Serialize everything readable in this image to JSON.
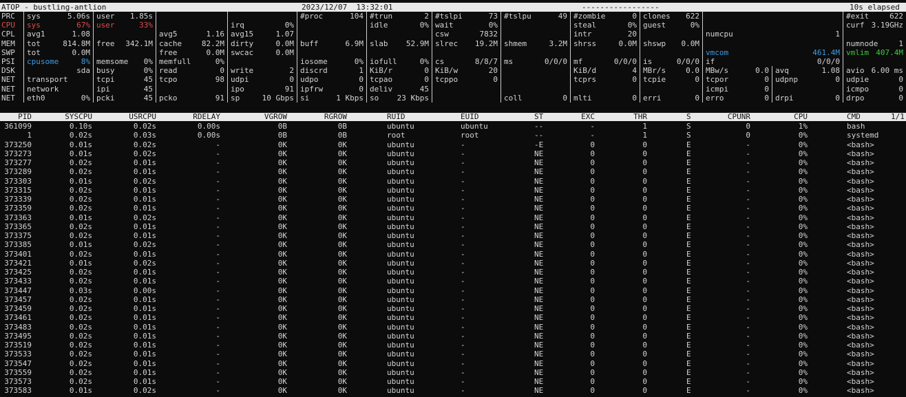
{
  "title": {
    "left": "ATOP - bustling-antlion",
    "datetime": "2023/12/07  13:32:01",
    "dashes": "-----------------",
    "elapsed": "10s elapsed"
  },
  "sysrows": [
    {
      "label": "PRC",
      "cells": [
        [
          "sys",
          "5.06s"
        ],
        [
          "user",
          "1.85s"
        ],
        [
          "",
          ""
        ],
        [
          "",
          ""
        ],
        [
          "#proc",
          "104"
        ],
        [
          "#trun",
          "2"
        ],
        [
          "#tslpi",
          "73"
        ],
        [
          "#tslpu",
          "49"
        ],
        [
          "#zombie",
          "0"
        ],
        [
          "clones",
          "622"
        ],
        [
          "",
          ""
        ],
        [
          "#exit",
          "622"
        ]
      ]
    },
    {
      "label": "CPU",
      "labelColor": "red",
      "cells": [
        [
          "sys",
          "67%",
          "red"
        ],
        [
          "user",
          "33%",
          "red"
        ],
        [
          "",
          ""
        ],
        [
          "irq",
          "0%"
        ],
        [
          "",
          ""
        ],
        [
          "idle",
          "0%"
        ],
        [
          "wait",
          "0%"
        ],
        [
          "",
          ""
        ],
        [
          "steal",
          "0%"
        ],
        [
          "guest",
          "0%"
        ],
        [
          "",
          ""
        ],
        [
          "curf",
          "3.19GHz"
        ]
      ]
    },
    {
      "label": "CPL",
      "cells": [
        [
          "avg1",
          "1.08"
        ],
        [
          "",
          ""
        ],
        [
          "avg5",
          "1.16"
        ],
        [
          "avg15",
          "1.07"
        ],
        [
          "",
          ""
        ],
        [
          "",
          ""
        ],
        [
          "csw",
          "7832"
        ],
        [
          "",
          ""
        ],
        [
          "intr",
          "20"
        ],
        [
          "",
          ""
        ],
        [
          "numcpu",
          "1"
        ],
        [
          "",
          ""
        ]
      ]
    },
    {
      "label": "MEM",
      "cells": [
        [
          "tot",
          "814.8M"
        ],
        [
          "free",
          "342.1M"
        ],
        [
          "cache",
          "82.2M"
        ],
        [
          "dirty",
          "0.0M"
        ],
        [
          "buff",
          "6.9M"
        ],
        [
          "slab",
          "52.9M"
        ],
        [
          "slrec",
          "19.2M"
        ],
        [
          "shmem",
          "3.2M"
        ],
        [
          "shrss",
          "0.0M"
        ],
        [
          "shswp",
          "0.0M"
        ],
        [
          "",
          ""
        ],
        [
          "numnode",
          "1"
        ]
      ]
    },
    {
      "label": "SWP",
      "cells": [
        [
          "tot",
          "0.0M"
        ],
        [
          "",
          ""
        ],
        [
          "free",
          "0.0M"
        ],
        [
          "swcac",
          "0.0M"
        ],
        [
          "",
          ""
        ],
        [
          "",
          ""
        ],
        [
          "",
          ""
        ],
        [
          "",
          ""
        ],
        [
          "",
          ""
        ],
        [
          "",
          ""
        ],
        [
          "vmcom",
          "461.4M",
          "blue"
        ],
        [
          "vmlim",
          "407.4M",
          "green"
        ]
      ]
    },
    {
      "label": "PSI",
      "cells": [
        [
          "cpusome",
          "8%",
          "blue"
        ],
        [
          "memsome",
          "0%"
        ],
        [
          "memfull",
          "0%"
        ],
        [
          "",
          ""
        ],
        [
          "iosome",
          "0%"
        ],
        [
          "iofull",
          "0%"
        ],
        [
          "cs",
          "8/8/7"
        ],
        [
          "ms",
          "0/0/0"
        ],
        [
          "mf",
          "0/0/0"
        ],
        [
          "is",
          "0/0/0"
        ],
        [
          "if",
          "0/0/0"
        ],
        [
          "",
          ""
        ]
      ]
    },
    {
      "label": "DSK",
      "cells": [
        [
          "",
          "sda"
        ],
        [
          "busy",
          "0%"
        ],
        [
          "read",
          "0"
        ],
        [
          "write",
          "2"
        ],
        [
          "discrd",
          "1"
        ],
        [
          "KiB/r",
          "0"
        ],
        [
          "KiB/w",
          "20"
        ],
        [
          "",
          ""
        ],
        [
          "KiB/d",
          "4"
        ],
        [
          "MBr/s",
          "0.0"
        ],
        [
          "MBw/s",
          "0.0"
        ],
        [
          "avq",
          "1.08"
        ],
        [
          "avio",
          "6.00 ms"
        ]
      ]
    },
    {
      "label": "NET",
      "cells": [
        [
          "transport",
          ""
        ],
        [
          "tcpi",
          "45"
        ],
        [
          "tcpo",
          "98"
        ],
        [
          "udpi",
          "0"
        ],
        [
          "udpo",
          "0"
        ],
        [
          "tcpao",
          "0"
        ],
        [
          "tcppo",
          "0"
        ],
        [
          "",
          ""
        ],
        [
          "tcprs",
          "0"
        ],
        [
          "tcpie",
          "0"
        ],
        [
          "tcpor",
          "0"
        ],
        [
          "udpnp",
          "0"
        ],
        [
          "udpie",
          "0"
        ]
      ]
    },
    {
      "label": "NET",
      "cells": [
        [
          "network",
          ""
        ],
        [
          "ipi",
          "45"
        ],
        [
          "",
          ""
        ],
        [
          "ipo",
          "91"
        ],
        [
          "ipfrw",
          "0"
        ],
        [
          "deliv",
          "45"
        ],
        [
          "",
          ""
        ],
        [
          "",
          ""
        ],
        [
          "",
          ""
        ],
        [
          "",
          ""
        ],
        [
          "icmpi",
          "0"
        ],
        [
          "",
          ""
        ],
        [
          "icmpo",
          "0"
        ]
      ]
    },
    {
      "label": "NET",
      "cells": [
        [
          "eth0",
          "0%"
        ],
        [
          "pcki",
          "45"
        ],
        [
          "pcko",
          "91"
        ],
        [
          "sp",
          "10 Gbps"
        ],
        [
          "si",
          "1 Kbps"
        ],
        [
          "so",
          "23 Kbps"
        ],
        [
          "",
          ""
        ],
        [
          "coll",
          "0"
        ],
        [
          "mlti",
          "0"
        ],
        [
          "erri",
          "0"
        ],
        [
          "erro",
          "0"
        ],
        [
          "drpi",
          "0"
        ],
        [
          "drpo",
          "0"
        ]
      ]
    }
  ],
  "columns": [
    "PID",
    "SYSCPU",
    "USRCPU",
    "RDELAY",
    "VGROW",
    "RGROW",
    "RUID",
    "EUID",
    "ST",
    "EXC",
    "THR",
    "S",
    "CPUNR",
    "CPU",
    "CMD",
    "1/1"
  ],
  "processes": [
    [
      "361099",
      "0.10s",
      "0.02s",
      "0.00s",
      "0B",
      "0B",
      "ubuntu",
      "ubuntu",
      "--",
      "-",
      "1",
      "S",
      "0",
      "1%",
      "bash"
    ],
    [
      "1",
      "0.02s",
      "0.03s",
      "0.00s",
      "0B",
      "0B",
      "root",
      "root",
      "--",
      "-",
      "1",
      "S",
      "0",
      "0%",
      "systemd"
    ],
    [
      "373250",
      "0.01s",
      "0.02s",
      "-",
      "0K",
      "0K",
      "ubuntu",
      "-",
      "-E",
      "0",
      "0",
      "E",
      "-",
      "0%",
      "<bash>"
    ],
    [
      "373273",
      "0.01s",
      "0.02s",
      "-",
      "0K",
      "0K",
      "ubuntu",
      "-",
      "NE",
      "0",
      "0",
      "E",
      "-",
      "0%",
      "<bash>"
    ],
    [
      "373277",
      "0.02s",
      "0.01s",
      "-",
      "0K",
      "0K",
      "ubuntu",
      "-",
      "NE",
      "0",
      "0",
      "E",
      "-",
      "0%",
      "<bash>"
    ],
    [
      "373289",
      "0.02s",
      "0.01s",
      "-",
      "0K",
      "0K",
      "ubuntu",
      "-",
      "NE",
      "0",
      "0",
      "E",
      "-",
      "0%",
      "<bash>"
    ],
    [
      "373303",
      "0.01s",
      "0.02s",
      "-",
      "0K",
      "0K",
      "ubuntu",
      "-",
      "NE",
      "0",
      "0",
      "E",
      "-",
      "0%",
      "<bash>"
    ],
    [
      "373315",
      "0.02s",
      "0.01s",
      "-",
      "0K",
      "0K",
      "ubuntu",
      "-",
      "NE",
      "0",
      "0",
      "E",
      "-",
      "0%",
      "<bash>"
    ],
    [
      "373339",
      "0.02s",
      "0.01s",
      "-",
      "0K",
      "0K",
      "ubuntu",
      "-",
      "NE",
      "0",
      "0",
      "E",
      "-",
      "0%",
      "<bash>"
    ],
    [
      "373359",
      "0.02s",
      "0.01s",
      "-",
      "0K",
      "0K",
      "ubuntu",
      "-",
      "NE",
      "0",
      "0",
      "E",
      "-",
      "0%",
      "<bash>"
    ],
    [
      "373363",
      "0.01s",
      "0.02s",
      "-",
      "0K",
      "0K",
      "ubuntu",
      "-",
      "NE",
      "0",
      "0",
      "E",
      "-",
      "0%",
      "<bash>"
    ],
    [
      "373365",
      "0.02s",
      "0.01s",
      "-",
      "0K",
      "0K",
      "ubuntu",
      "-",
      "NE",
      "0",
      "0",
      "E",
      "-",
      "0%",
      "<bash>"
    ],
    [
      "373375",
      "0.02s",
      "0.01s",
      "-",
      "0K",
      "0K",
      "ubuntu",
      "-",
      "NE",
      "0",
      "0",
      "E",
      "-",
      "0%",
      "<bash>"
    ],
    [
      "373385",
      "0.01s",
      "0.02s",
      "-",
      "0K",
      "0K",
      "ubuntu",
      "-",
      "NE",
      "0",
      "0",
      "E",
      "-",
      "0%",
      "<bash>"
    ],
    [
      "373401",
      "0.02s",
      "0.01s",
      "-",
      "0K",
      "0K",
      "ubuntu",
      "-",
      "NE",
      "0",
      "0",
      "E",
      "-",
      "0%",
      "<bash>"
    ],
    [
      "373421",
      "0.01s",
      "0.02s",
      "-",
      "0K",
      "0K",
      "ubuntu",
      "-",
      "NE",
      "0",
      "0",
      "E",
      "-",
      "0%",
      "<bash>"
    ],
    [
      "373425",
      "0.02s",
      "0.01s",
      "-",
      "0K",
      "0K",
      "ubuntu",
      "-",
      "NE",
      "0",
      "0",
      "E",
      "-",
      "0%",
      "<bash>"
    ],
    [
      "373433",
      "0.02s",
      "0.01s",
      "-",
      "0K",
      "0K",
      "ubuntu",
      "-",
      "NE",
      "0",
      "0",
      "E",
      "-",
      "0%",
      "<bash>"
    ],
    [
      "373447",
      "0.03s",
      "0.00s",
      "-",
      "0K",
      "0K",
      "ubuntu",
      "-",
      "NE",
      "0",
      "0",
      "E",
      "-",
      "0%",
      "<bash>"
    ],
    [
      "373457",
      "0.02s",
      "0.01s",
      "-",
      "0K",
      "0K",
      "ubuntu",
      "-",
      "NE",
      "0",
      "0",
      "E",
      "-",
      "0%",
      "<bash>"
    ],
    [
      "373459",
      "0.02s",
      "0.01s",
      "-",
      "0K",
      "0K",
      "ubuntu",
      "-",
      "NE",
      "0",
      "0",
      "E",
      "-",
      "0%",
      "<bash>"
    ],
    [
      "373461",
      "0.02s",
      "0.01s",
      "-",
      "0K",
      "0K",
      "ubuntu",
      "-",
      "NE",
      "0",
      "0",
      "E",
      "-",
      "0%",
      "<bash>"
    ],
    [
      "373483",
      "0.02s",
      "0.01s",
      "-",
      "0K",
      "0K",
      "ubuntu",
      "-",
      "NE",
      "0",
      "0",
      "E",
      "-",
      "0%",
      "<bash>"
    ],
    [
      "373495",
      "0.02s",
      "0.01s",
      "-",
      "0K",
      "0K",
      "ubuntu",
      "-",
      "NE",
      "0",
      "0",
      "E",
      "-",
      "0%",
      "<bash>"
    ],
    [
      "373519",
      "0.02s",
      "0.01s",
      "-",
      "0K",
      "0K",
      "ubuntu",
      "-",
      "NE",
      "0",
      "0",
      "E",
      "-",
      "0%",
      "<bash>"
    ],
    [
      "373533",
      "0.02s",
      "0.01s",
      "-",
      "0K",
      "0K",
      "ubuntu",
      "-",
      "NE",
      "0",
      "0",
      "E",
      "-",
      "0%",
      "<bash>"
    ],
    [
      "373547",
      "0.02s",
      "0.01s",
      "-",
      "0K",
      "0K",
      "ubuntu",
      "-",
      "NE",
      "0",
      "0",
      "E",
      "-",
      "0%",
      "<bash>"
    ],
    [
      "373559",
      "0.02s",
      "0.01s",
      "-",
      "0K",
      "0K",
      "ubuntu",
      "-",
      "NE",
      "0",
      "0",
      "E",
      "-",
      "0%",
      "<bash>"
    ],
    [
      "373573",
      "0.02s",
      "0.01s",
      "-",
      "0K",
      "0K",
      "ubuntu",
      "-",
      "NE",
      "0",
      "0",
      "E",
      "-",
      "0%",
      "<bash>"
    ],
    [
      "373583",
      "0.01s",
      "0.02s",
      "-",
      "0K",
      "0K",
      "ubuntu",
      "-",
      "NE",
      "0",
      "0",
      "E",
      "-",
      "0%",
      "<bash>"
    ]
  ],
  "colors": {
    "background": "#0c0c0c",
    "text": "#d4d4d4",
    "header_bg": "#e8e8e8",
    "red": "#e04a4a",
    "blue": "#3b9ce6",
    "green": "#3ec93e"
  }
}
